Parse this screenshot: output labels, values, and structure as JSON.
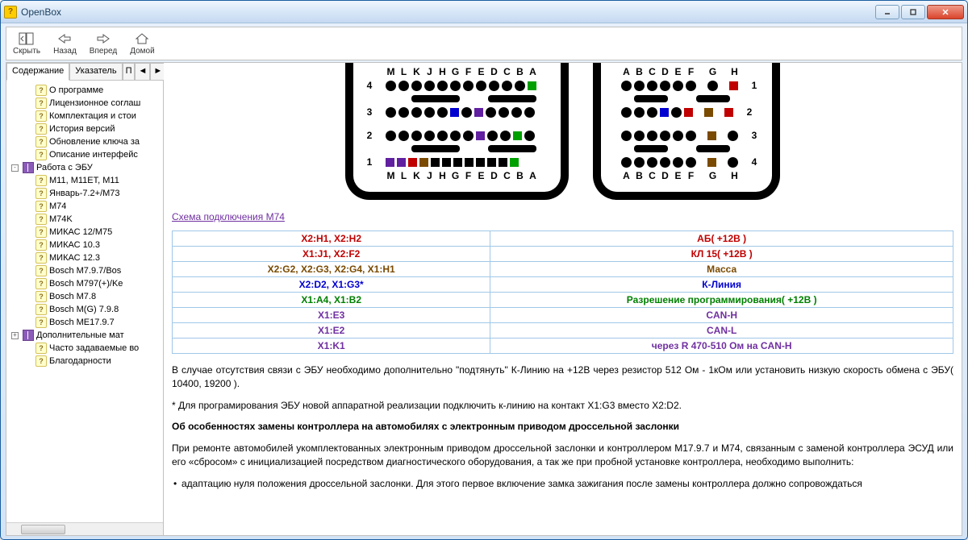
{
  "window": {
    "title": "OpenBox"
  },
  "toolbar": {
    "hide": "Скрыть",
    "back": "Назад",
    "forward": "Вперед",
    "home": "Домой"
  },
  "tabs": {
    "contents": "Содержание",
    "index": "Указатель",
    "search": "П",
    "arrow1": "◄",
    "arrow2": "►"
  },
  "tree": [
    {
      "label": "О программе",
      "level": 2,
      "icon": "q"
    },
    {
      "label": "Лицензионное соглаш",
      "level": 2,
      "icon": "q"
    },
    {
      "label": "Комплектация и стои",
      "level": 2,
      "icon": "q"
    },
    {
      "label": "История версий",
      "level": 2,
      "icon": "q"
    },
    {
      "label": "Обновление ключа за",
      "level": 2,
      "icon": "q"
    },
    {
      "label": "Описание интерфейс",
      "level": 2,
      "icon": "q"
    },
    {
      "label": "Работа с ЭБУ",
      "level": 1,
      "icon": "book",
      "exp": "-"
    },
    {
      "label": "М11, М11ЕТ, М11",
      "level": 2,
      "icon": "q"
    },
    {
      "label": "Январь-7.2+/М73",
      "level": 2,
      "icon": "q"
    },
    {
      "label": "М74",
      "level": 2,
      "icon": "q"
    },
    {
      "label": "М74K",
      "level": 2,
      "icon": "q"
    },
    {
      "label": "МИКАС 12/М75",
      "level": 2,
      "icon": "q"
    },
    {
      "label": "МИКАС 10.3",
      "level": 2,
      "icon": "q"
    },
    {
      "label": "МИКАС 12.3",
      "level": 2,
      "icon": "q"
    },
    {
      "label": "Bosch M7.9.7/Bos",
      "level": 2,
      "icon": "q"
    },
    {
      "label": "Bosch M797(+)/Ke",
      "level": 2,
      "icon": "q"
    },
    {
      "label": "Bosch M7.8",
      "level": 2,
      "icon": "q"
    },
    {
      "label": "Bosch M(G) 7.9.8",
      "level": 2,
      "icon": "q"
    },
    {
      "label": "Bosch ME17.9.7",
      "level": 2,
      "icon": "q"
    },
    {
      "label": "Дополнительные мат",
      "level": 1,
      "icon": "book",
      "exp": "+"
    },
    {
      "label": "Часто задаваемые во",
      "level": 2,
      "icon": "q"
    },
    {
      "label": "Благодарности",
      "level": 2,
      "icon": "q"
    }
  ],
  "schema_link": "Схема подключения М74",
  "table": [
    {
      "pins": "X2:H1, X2:H2",
      "desc": "АБ( +12В )",
      "color": "#c00000"
    },
    {
      "pins": "X1:J1, X2:F2",
      "desc": "КЛ 15( +12В )",
      "color": "#c00000"
    },
    {
      "pins": "X2:G2, X2:G3, X2:G4, X1:H1",
      "desc": "Масса",
      "color": "#7a4a00"
    },
    {
      "pins": "X2:D2, X1:G3*",
      "desc": "К-Линия",
      "color": "#0000d0"
    },
    {
      "pins": "X1:A4, X1:B2",
      "desc": "Разрешение программирования( +12В )",
      "color": "#008000"
    },
    {
      "pins": "X1:E3",
      "desc": "CAN-H",
      "color": "#7030a0"
    },
    {
      "pins": "X1:E2",
      "desc": "CAN-L",
      "color": "#7030a0"
    },
    {
      "pins": "X1:K1",
      "desc": "через R 470-510 Ом на CAN-H",
      "color": "#7030a0"
    }
  ],
  "text": {
    "p1": "В случае отсутствия связи с ЭБУ необходимо дополнительно \"подтянуть\" К-Линию на +12В через резистор 512 Ом - 1кОм или установить низкую скорость обмена с ЭБУ( 10400, 19200 ).",
    "p2": "* Для програмирования ЭБУ новой аппаратной реализации подключить к-линию на контакт X1:G3 вместо X2:D2.",
    "h1": "Об особенностях замены контроллера на автомобилях с электронным приводом дроссельной заслонки",
    "p3": "При ремонте автомобилей укомплектованных электронным приводом дроссельной заслонки и контроллером М17.9.7 и М74, связанным с заменой контроллера ЭСУД или его «сбросом» с инициализацией посредством диагностического оборудования, а так же при пробной установке контроллера, необходимо выполнить:",
    "b1": "адаптацию нуля положения дроссельной заслонки. Для этого первое включение замка зажигания после замены контроллера должно сопровождаться"
  },
  "conn_left": {
    "top_hdr": [
      "M",
      "L",
      "K",
      "J",
      "H",
      "G",
      "F",
      "E",
      "D",
      "C",
      "B",
      "A"
    ],
    "bot_hdr": [
      "M",
      "L",
      "K",
      "J",
      "H",
      "G",
      "F",
      "E",
      "D",
      "C",
      "B",
      "A"
    ],
    "row4_sq": "#00a000",
    "row1_sqs": [
      "#6020a0",
      "#6020a0",
      "#c00000",
      "#7a4a00",
      "#000",
      "#000",
      "#000",
      "#000",
      "#000",
      "#000",
      "#000",
      "#00a000"
    ]
  },
  "conn_right": {
    "top_hdr": [
      "A",
      "B",
      "C",
      "D",
      "E",
      "F",
      "",
      "G",
      "",
      "H"
    ],
    "bot_hdr": [
      "A",
      "B",
      "C",
      "D",
      "E",
      "F",
      "",
      "G",
      "",
      "H"
    ]
  }
}
